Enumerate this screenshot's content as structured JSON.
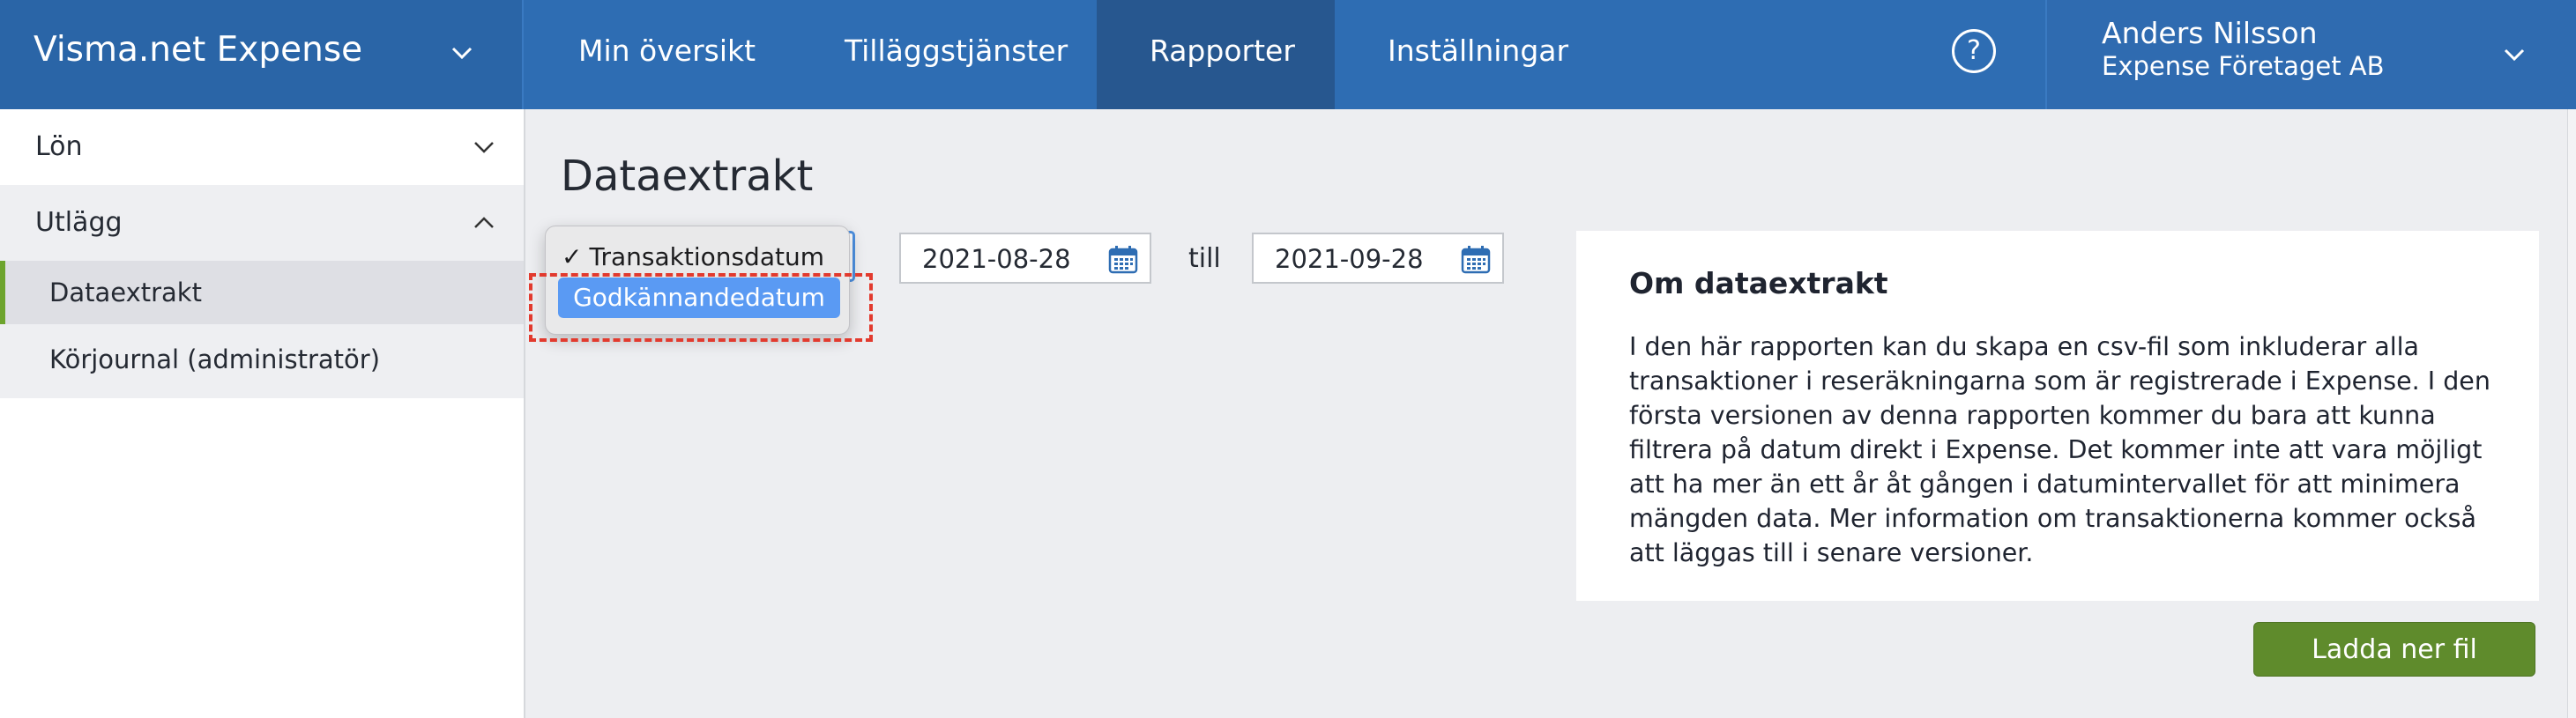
{
  "app": {
    "title": "Visma.net Expense"
  },
  "nav": {
    "items": [
      {
        "label": "Min översikt",
        "active": false
      },
      {
        "label": "Tilläggstjänster",
        "active": false
      },
      {
        "label": "Rapporter",
        "active": true
      },
      {
        "label": "Inställningar",
        "active": false
      }
    ],
    "help_icon": "question-circle-icon"
  },
  "user": {
    "name": "Anders Nilsson",
    "company": "Expense Företaget AB"
  },
  "sidebar": {
    "groups": [
      {
        "label": "Lön",
        "expanded": false
      },
      {
        "label": "Utlägg",
        "expanded": true
      }
    ],
    "subitems": [
      {
        "label": "Dataextrakt",
        "active": true
      },
      {
        "label": "Körjournal (administratör)",
        "active": false
      }
    ]
  },
  "main": {
    "title": "Dataextrakt",
    "date_type_select": {
      "options": [
        {
          "label": "Transaktionsdatum",
          "checked": true
        },
        {
          "label": "Godkännandedatum",
          "highlighted": true
        }
      ]
    },
    "from_date": "2021-08-28",
    "till_label": "till",
    "to_date": "2021-09-28",
    "download_label": "Ladda ner fil"
  },
  "info": {
    "title": "Om dataextrakt",
    "body": "I den här rapporten kan du skapa en csv-fil som inkluderar alla transaktioner i reseräkningarna som är registrerade i Expense. I den första versionen av denna rapporten kommer du bara att kunna filtrera på datum direkt i Expense. Det kommer inte att vara möjligt att ha mer än ett år åt gången i datumintervallet för att minimera mängden data. Mer information om transaktionerna kommer också att läggas till i senare versioner."
  },
  "colors": {
    "header": "#2e6db3",
    "nav_active": "#27578f",
    "accent_green": "#6da42d",
    "button_green": "#5f8b2c",
    "highlight_red": "#e23a2e",
    "option_blue": "#5a9af3"
  }
}
